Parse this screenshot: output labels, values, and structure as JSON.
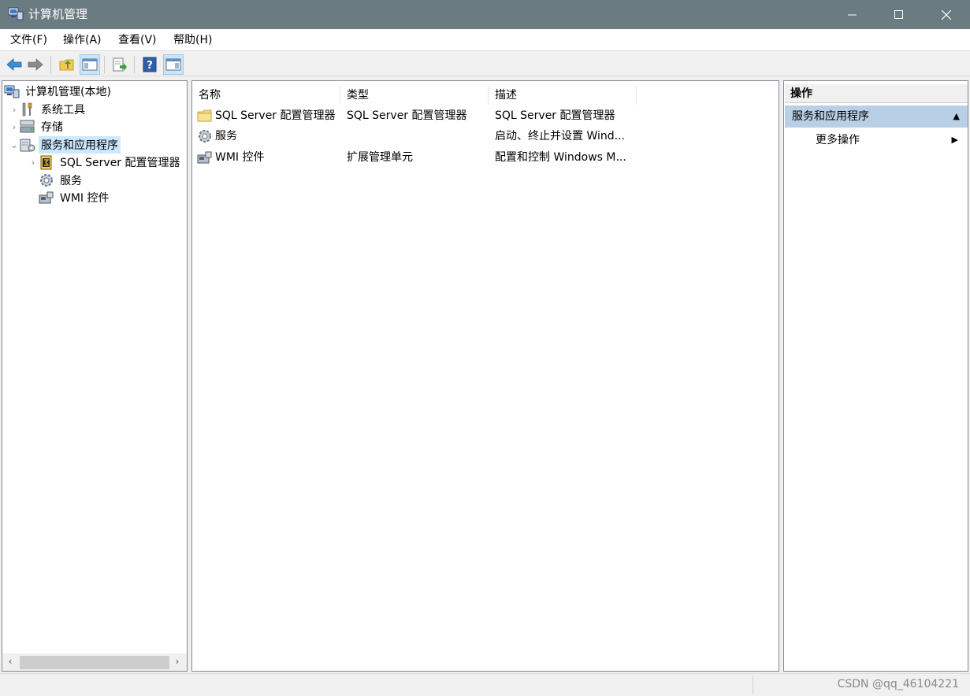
{
  "window": {
    "title": "计算机管理",
    "colors": {
      "titlebar": "#6b7b82",
      "selection": "#cce8ff",
      "section": "#b9cfe5"
    }
  },
  "menu": [
    "文件(F)",
    "操作(A)",
    "查看(V)",
    "帮助(H)"
  ],
  "toolbar": [
    "back-arrow-icon",
    "forward-arrow-icon",
    "up-folder-icon",
    "show-hide-tree-icon",
    "export-list-icon",
    "help-icon",
    "show-hide-action-pane-icon"
  ],
  "tree": {
    "root": "计算机管理(本地)",
    "items": [
      {
        "label": "系统工具",
        "icon": "tools-icon"
      },
      {
        "label": "存储",
        "icon": "storage-icon"
      },
      {
        "label": "服务和应用程序",
        "icon": "services-apps-icon",
        "selected": true
      },
      {
        "label": "SQL Server 配置管理器",
        "icon": "sql-server-icon"
      },
      {
        "label": "服务",
        "icon": "gear-icon"
      },
      {
        "label": "WMI 控件",
        "icon": "wmi-icon"
      }
    ]
  },
  "list": {
    "columns": [
      "名称",
      "类型",
      "描述"
    ],
    "rows": [
      {
        "name": "SQL Server 配置管理器",
        "type": "SQL Server 配置管理器",
        "desc": "SQL Server 配置管理器",
        "icon": "folder-icon"
      },
      {
        "name": "服务",
        "type": "",
        "desc": "启动、终止并设置 Wind...",
        "icon": "gear-icon"
      },
      {
        "name": "WMI 控件",
        "type": "扩展管理单元",
        "desc": "配置和控制 Windows M...",
        "icon": "wmi-icon"
      }
    ]
  },
  "actions": {
    "header": "操作",
    "section": "服务和应用程序",
    "items": [
      "更多操作"
    ]
  },
  "status": {
    "watermark": "CSDN @qq_46104221"
  }
}
